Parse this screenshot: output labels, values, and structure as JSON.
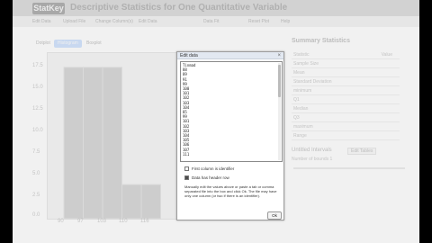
{
  "app": {
    "logo": "StatKey",
    "title": "Descriptive Statistics for One Quantitative Variable"
  },
  "toolbar": {
    "buttons": [
      "Edit Data",
      "Upload File",
      "Change Column(s)",
      "Edit Data",
      "Data Fit",
      "Reset Plot",
      "Help"
    ]
  },
  "chart_tabs": [
    "Dotplot",
    "Histogram",
    "Boxplot"
  ],
  "chart_data": {
    "type": "bar",
    "categories": [
      "90",
      "97",
      "103",
      "110",
      "116"
    ],
    "values": [
      16,
      16,
      16,
      3.6,
      3.6
    ],
    "ylabels": [
      "17.5",
      "15.0",
      "12.5",
      "10.0",
      "7.5",
      "5.0",
      "2.5",
      "0.0"
    ],
    "ylim": [
      0,
      17.5
    ]
  },
  "stats": {
    "title": "Summary Statistics",
    "rows": [
      {
        "key": "Statistic",
        "value": "Value"
      },
      {
        "key": "Sample Size",
        "value": ""
      },
      {
        "key": "Mean",
        "value": ""
      },
      {
        "key": "Standard Deviation",
        "value": ""
      },
      {
        "key": "minimum",
        "value": ""
      },
      {
        "key": "Q1",
        "value": ""
      },
      {
        "key": "Median",
        "value": ""
      },
      {
        "key": "Q3",
        "value": ""
      },
      {
        "key": "maximum",
        "value": ""
      },
      {
        "key": "Range",
        "value": ""
      }
    ]
  },
  "interval": {
    "title": "Untitled Intervals",
    "button": "Edit Tables",
    "sub": "Number of bounds 1"
  },
  "dialog": {
    "title": "Edit data",
    "close": "×",
    "data_lines": [
      "Tinmad",
      "88",
      "89",
      "91",
      "99",
      "100",
      "101",
      "102",
      "103",
      "104",
      "85",
      "99",
      "101",
      "102",
      "103",
      "104",
      "105",
      "106",
      "107",
      "111"
    ],
    "chk1": "First column is identifier",
    "chk2": "Data has header row",
    "instructions": "Manually edit the values above or paste a tab or comma separated file into the box and click Ok. The file may have only one column (or two if there is an identifier).",
    "ok": "Ok"
  }
}
